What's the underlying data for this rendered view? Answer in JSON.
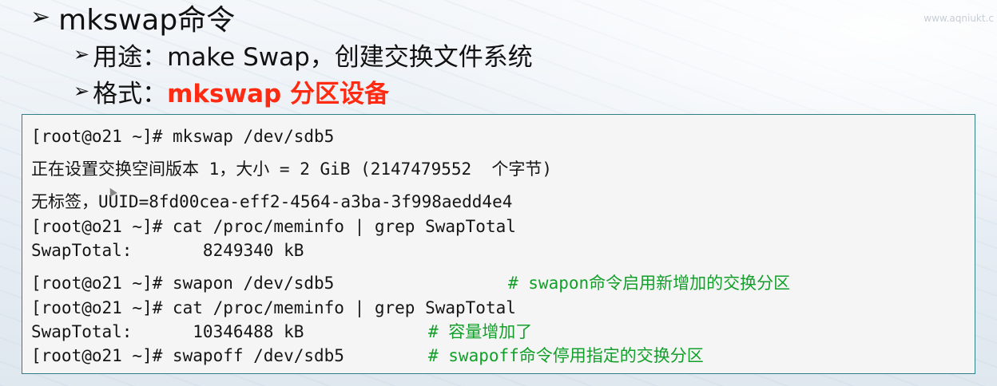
{
  "watermark": "www.aqniukt.c",
  "heading": {
    "arrow": "➢",
    "title": "mkswap命令"
  },
  "usage": {
    "arrow": "➢",
    "label": "用途：",
    "value": "make Swap，创建交换文件系统"
  },
  "format": {
    "arrow": "➢",
    "label": "格式：",
    "value": "mkswap 分区设备",
    "value_color": "#ff2a12"
  },
  "terminal": {
    "lines": [
      "[root@o21 ~]# mkswap /dev/sdb5",
      "正在设置交换空间版本 1，大小 = 2 GiB (2147479552  个字节)",
      "无标签，UUID=8fd00cea-eff2-4564-a3ba-3f998aedd4e4",
      "[root@o21 ~]# cat /proc/meminfo | grep SwapTotal",
      "SwapTotal:       8249340 kB",
      "[root@o21 ~]# swapon /dev/sdb5",
      "[root@o21 ~]# cat /proc/meminfo | grep SwapTotal",
      "SwapTotal:      10346488 kB",
      "[root@o21 ~]# swapoff /dev/sdb5"
    ],
    "comments": {
      "swapon": "# swapon命令启用新增加的交换分区",
      "capacity": "# 容量增加了",
      "swapoff": "# swapoff命令停用指定的交换分区"
    },
    "comment_color": "#12a02a"
  }
}
